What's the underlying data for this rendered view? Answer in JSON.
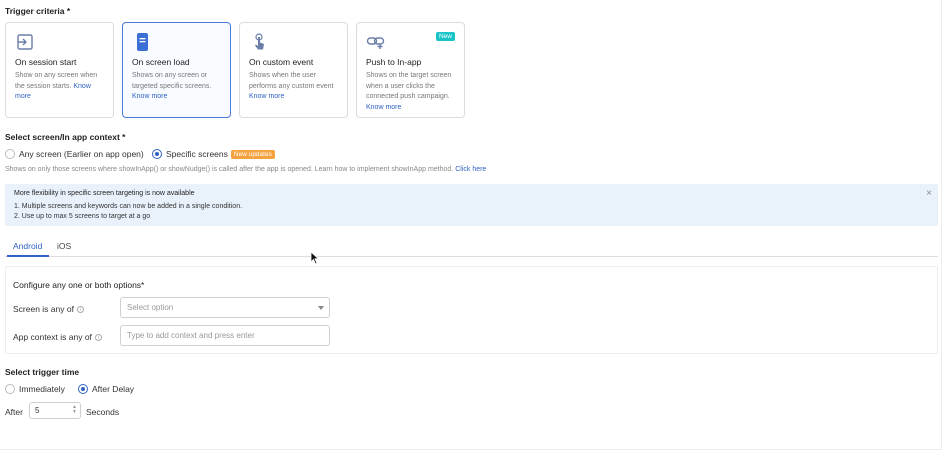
{
  "trigger_criteria": {
    "title": "Trigger criteria *",
    "cards": [
      {
        "title": "On session start",
        "desc": "Show on any screen when the session starts.",
        "link": "Know more",
        "icon": "session-start-icon",
        "selected": false
      },
      {
        "title": "On screen load",
        "desc": "Shows on any screen or targeted specific screens.",
        "link": "Know more",
        "icon": "screen-load-icon",
        "selected": true
      },
      {
        "title": "On custom event",
        "desc": "Shows when the user performs any custom event",
        "link": "Know more",
        "icon": "custom-event-icon",
        "selected": false
      },
      {
        "title": "Push to In-app",
        "desc": "Shows on the target screen when a user clicks the connected push campaign.",
        "link": "Know more",
        "icon": "push-link-icon",
        "badge": "New",
        "selected": false
      }
    ]
  },
  "screen_context": {
    "title": "Select screen/In app context *",
    "options": [
      {
        "label": "Any screen (Earlier on app open)",
        "selected": false
      },
      {
        "label": "Specific screens",
        "selected": true,
        "badge": "New updates"
      }
    ],
    "note": "Shows on only those screens where showInApp() or showNudge() is called after the app is opened. Learn how to implement showInApp method.",
    "note_link": "Click here"
  },
  "info_banner": {
    "title": "More flexibility in specific screen targeting is now available",
    "lines": [
      "1. Multiple screens and keywords can now be added in a single condition.",
      "2. Use up to max 5 screens to target at a go"
    ],
    "close": "×"
  },
  "platform_tabs": [
    "Android",
    "iOS"
  ],
  "config": {
    "title": "Configure any one or both options*",
    "screen_label": "Screen is any of",
    "screen_placeholder": "Select option",
    "context_label": "App context is any of",
    "context_placeholder": "Type to add context and press enter"
  },
  "trigger_time": {
    "title": "Select trigger time",
    "options": [
      {
        "label": "Immediately",
        "selected": false
      },
      {
        "label": "After Delay",
        "selected": true
      }
    ],
    "after_label": "After",
    "delay_value": "5",
    "unit": "Seconds"
  },
  "colors": {
    "accent": "#2f62c5",
    "new_badge": "#18c4c8",
    "updates_badge": "#f4a340",
    "banner_bg": "#e9f2fb"
  }
}
